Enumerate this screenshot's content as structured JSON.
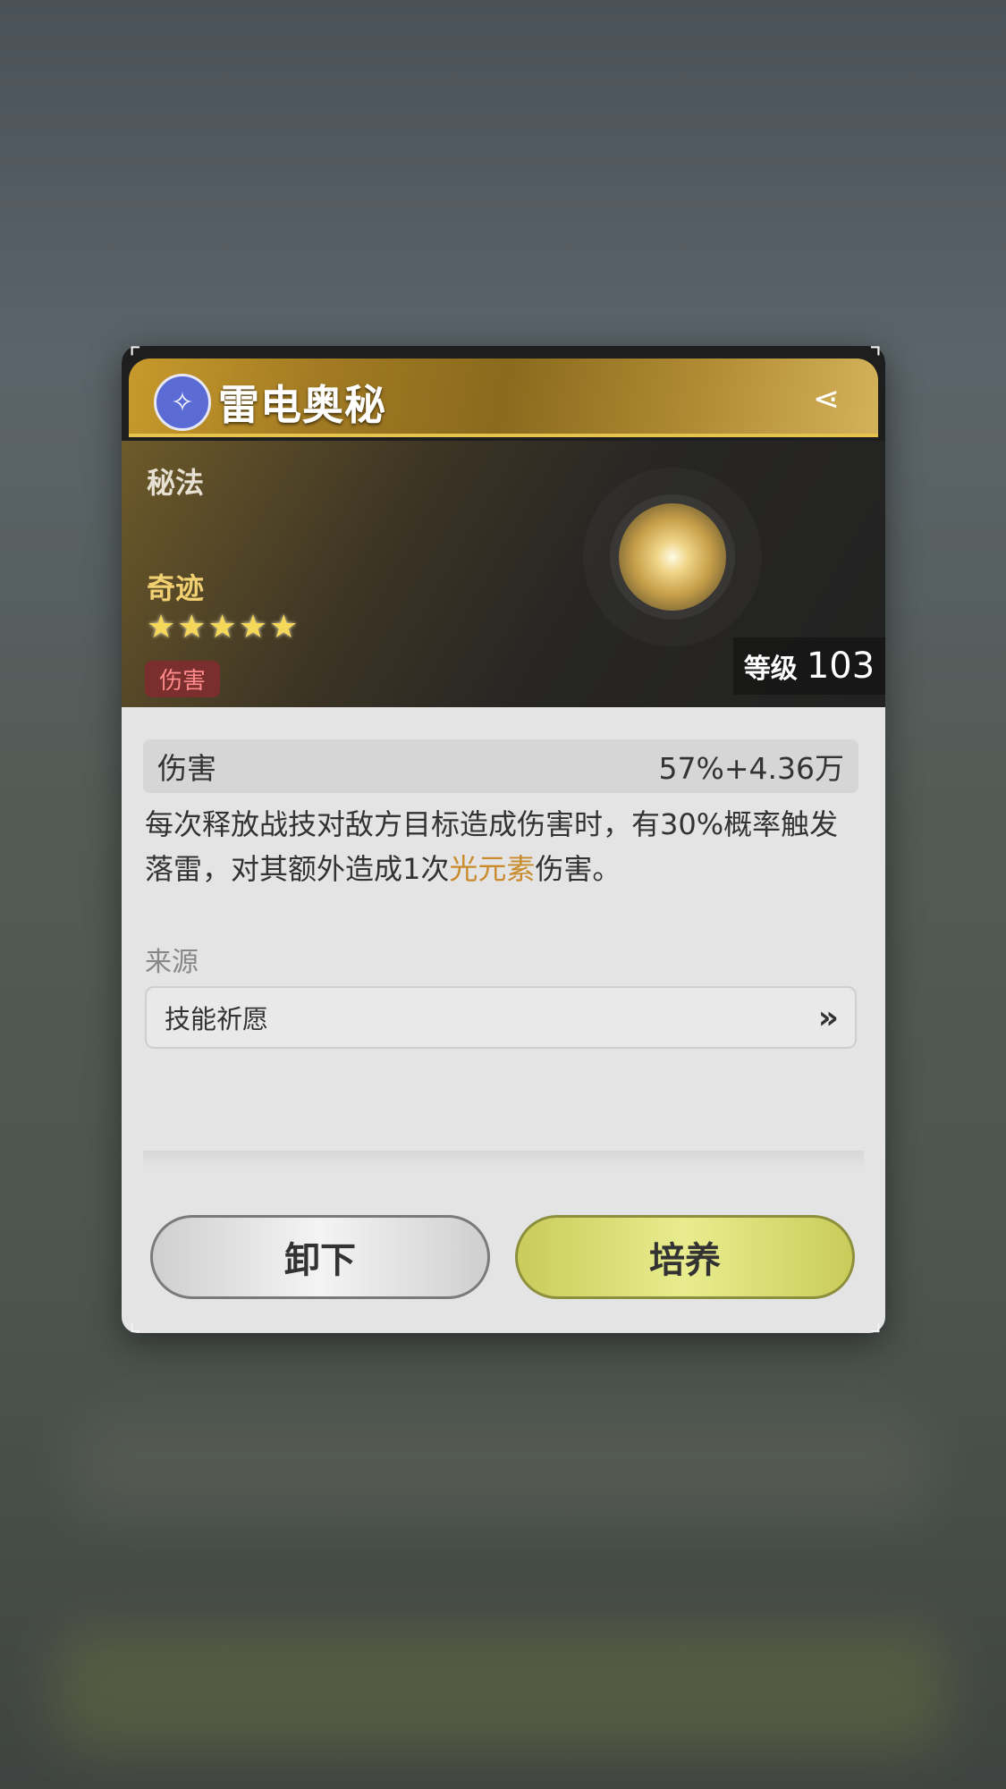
{
  "header": {
    "title": "雷电奥秘",
    "element_icon": "element-lightning-icon",
    "share_icon": "share-icon"
  },
  "hero": {
    "category": "秘法",
    "rarity": "奇迹",
    "stars": "★★★★★",
    "tag": "伤害",
    "level_label": "等级",
    "level_value": "103"
  },
  "stat": {
    "label": "伤害",
    "value": "57%+4.36万"
  },
  "description": {
    "part1": "每次释放战技对敌方目标造成伤害时，有30%概率触发落雷，对其额外造成1次",
    "highlight": "光元素",
    "part2": "伤害。"
  },
  "source": {
    "label": "来源",
    "item": "技能祈愿"
  },
  "buttons": {
    "unequip": "卸下",
    "cultivate": "培养"
  },
  "colors": {
    "highlight": "#c98b2c",
    "cultivate_button": "#dfe27a",
    "tag_bg": "#7a2e2e"
  }
}
